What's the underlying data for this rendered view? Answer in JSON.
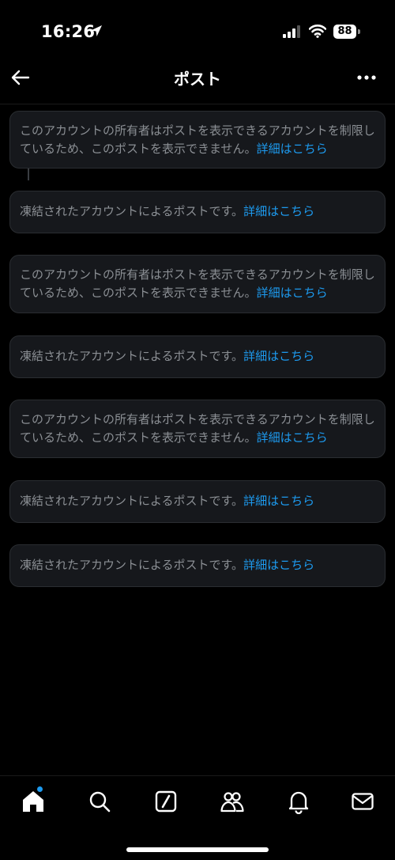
{
  "status_bar": {
    "time": "16:26",
    "battery": "88"
  },
  "header": {
    "title": "ポスト"
  },
  "notices": [
    {
      "text": "このアカウントの所有者はポストを表示できるアカウントを制限しているため、このポストを表示できません。",
      "link": "詳細はこちら"
    },
    {
      "text": "凍結されたアカウントによるポストです。",
      "link": "詳細はこちら"
    },
    {
      "text": "このアカウントの所有者はポストを表示できるアカウントを制限しているため、このポストを表示できません。",
      "link": "詳細はこちら"
    },
    {
      "text": "凍結されたアカウントによるポストです。",
      "link": "詳細はこちら"
    },
    {
      "text": "このアカウントの所有者はポストを表示できるアカウントを制限しているため、このポストを表示できません。",
      "link": "詳細はこちら"
    },
    {
      "text": "凍結されたアカウントによるポストです。",
      "link": "詳細はこちら"
    },
    {
      "text": "凍結されたアカウントによるポストです。",
      "link": "詳細はこちら"
    }
  ],
  "colors": {
    "accent": "#1d9bf0",
    "card_bg": "#16181c",
    "muted_text": "#8b8f94"
  },
  "nav": {
    "items": [
      "home-icon",
      "search-icon",
      "grok-icon",
      "communities-icon",
      "bell-icon",
      "mail-icon"
    ]
  }
}
